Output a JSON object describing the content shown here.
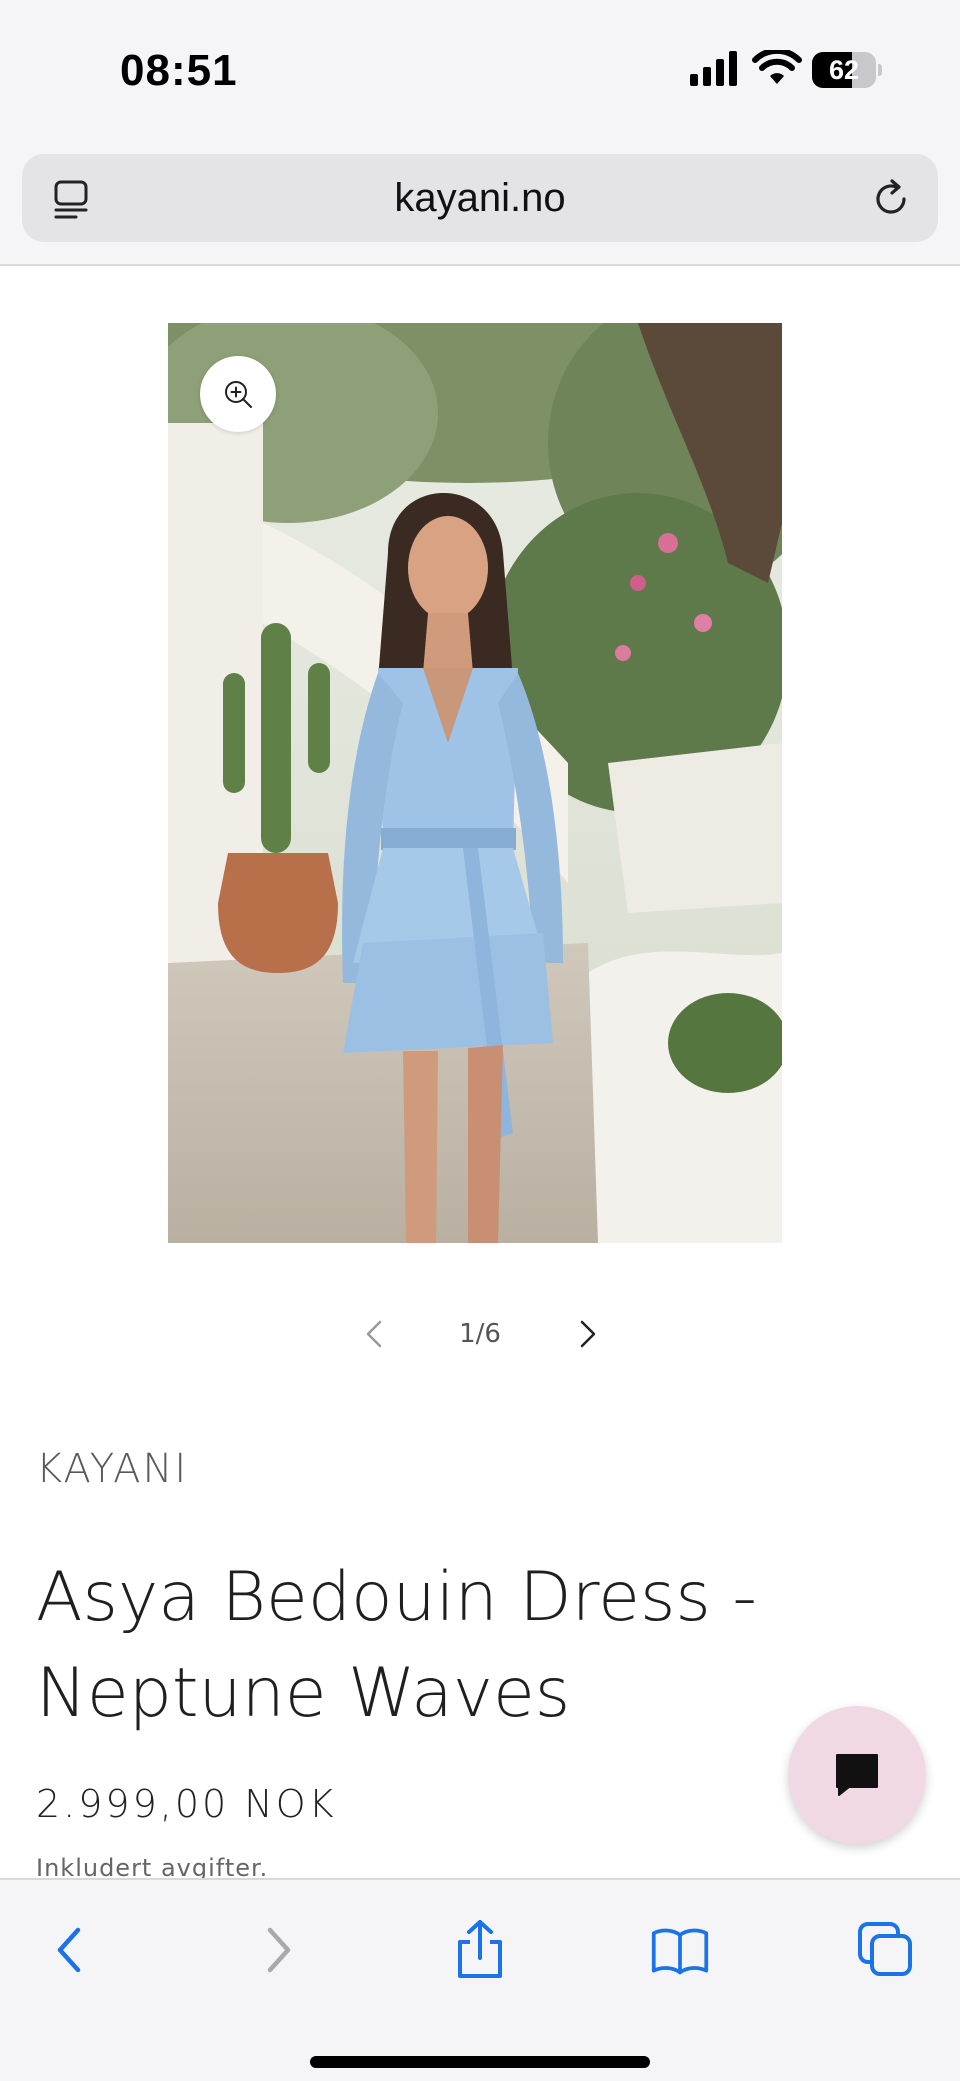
{
  "status_bar": {
    "time": "08:51",
    "battery_percent": "62",
    "battery_level": 0.62,
    "icons": [
      "signal-icon",
      "wifi-icon",
      "battery-icon"
    ]
  },
  "browser": {
    "url": "kayani.no",
    "icons": [
      "tabs-overview-icon",
      "reload-icon"
    ],
    "toolbar_icons": [
      "back-icon",
      "forward-icon",
      "share-icon",
      "bookmarks-icon",
      "tabs-icon"
    ]
  },
  "gallery": {
    "counter": "1/6",
    "icons": [
      "zoom-in-icon",
      "chevron-left-icon",
      "chevron-right-icon"
    ]
  },
  "product": {
    "vendor": "KAYANI",
    "title": "Asya Bedouin Dress - Neptune Waves",
    "price": "2.999,00 NOK",
    "tax_note": "Inkludert avgifter."
  },
  "chat": {
    "icon": "chat-bubble-icon"
  },
  "colors": {
    "browser_chrome": "#f5f5f7",
    "address_bar": "#e4e4e6",
    "toolbar_accent": "#1a73e8",
    "chat_button": "#f0d9e5",
    "dress_blue": "#9fc3e6"
  }
}
